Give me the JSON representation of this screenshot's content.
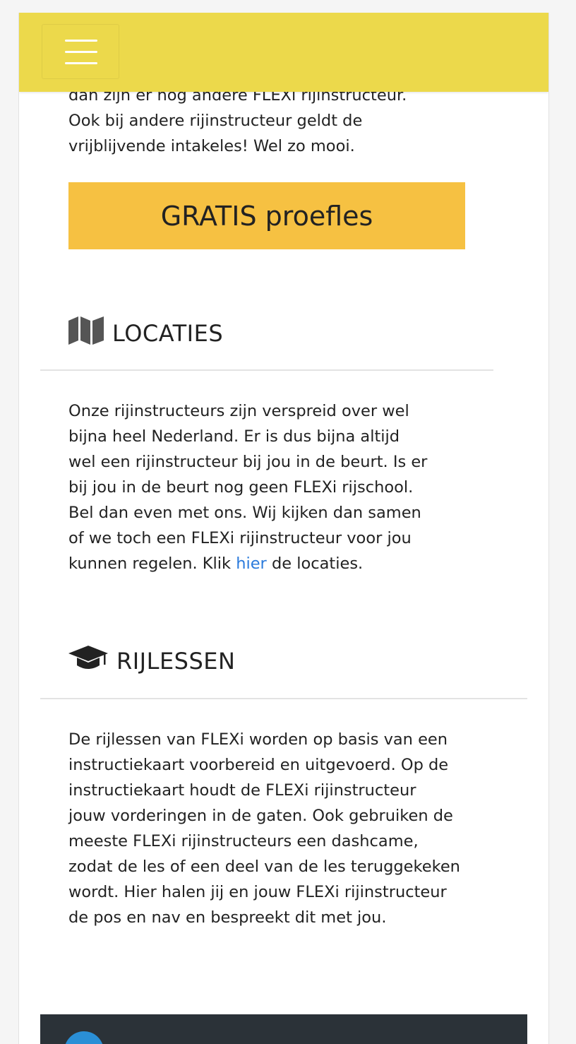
{
  "navbar": {
    "menu_icon": "hamburger-menu-icon",
    "background": "#ecd94b"
  },
  "intro": {
    "line1": "dan zijn er nog andere FLEXi rijinstructeur.",
    "line2": "Ook bij andere rijinstructeur geldt de",
    "line3": "vrijblijvende intakeles! Wel zo mooi."
  },
  "cta": {
    "label": "GRATIS proefles",
    "color": "#f6c142"
  },
  "locaties": {
    "icon": "map-icon",
    "heading": "LOCATIES",
    "lines": [
      "Onze rijinstructeurs zijn verspreid over wel",
      "bijna heel Nederland. Er is dus bijna altijd",
      "wel een rijinstructeur bij jou in de beurt. Is er",
      "bij jou in de beurt nog geen FLEXi rijschool.",
      "Bel dan even met ons. Wij kijken dan samen",
      "of we toch een FLEXi rijinstructeur voor jou"
    ],
    "last_line_before": "kunnen regelen. Klik ",
    "link_text": "hier",
    "last_line_after": " de locaties.",
    "link_color": "#2b7bdc"
  },
  "rijlessen": {
    "icon": "graduation-cap-icon",
    "heading": "RIJLESSEN",
    "lines": [
      "De rijlessen van FLEXi worden op basis van een",
      "instructiekaart voorbereid en uitgevoerd. Op de",
      "instructiekaart houdt de FLEXi rijinstructeur",
      "jouw vorderingen in de gaten. Ook gebruiken de",
      "meeste FLEXi rijinstructeurs een dashcame,",
      "zodat de les of een deel van de les teruggekeken",
      "wordt. Hier halen jij en jouw FLEXi rijinstructeur",
      "de pos en nav en bespreekt dit met jou."
    ]
  },
  "video": {
    "icon": "play-button-icon"
  }
}
